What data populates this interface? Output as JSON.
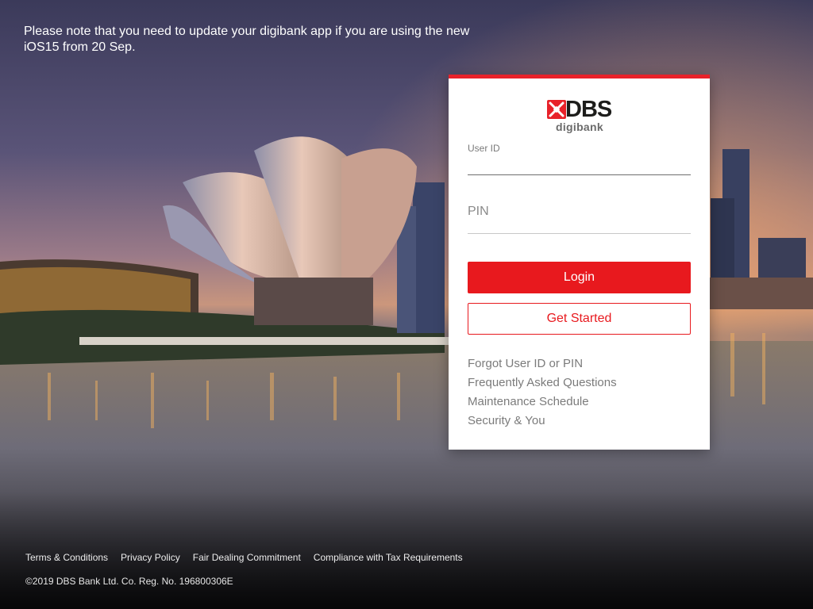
{
  "notice": {
    "text": "Please note that you need to update your digibank app if you are using the new iOS15 from 20 Sep."
  },
  "brand": {
    "name": "DBS",
    "product": "digibank",
    "accent": "#e8222a"
  },
  "login_form": {
    "user_id_label": "User ID",
    "user_id_value": "",
    "pin_placeholder": "PIN",
    "login_label": "Login",
    "get_started_label": "Get Started"
  },
  "help_links": [
    "Forgot User ID or PIN",
    "Frequently Asked Questions",
    "Maintenance Schedule",
    "Security & You"
  ],
  "footer": {
    "links": [
      "Terms & Conditions",
      "Privacy Policy",
      "Fair Dealing Commitment",
      "Compliance with Tax Requirements"
    ],
    "copyright": "©2019 DBS Bank Ltd. Co. Reg. No. 196800306E"
  }
}
